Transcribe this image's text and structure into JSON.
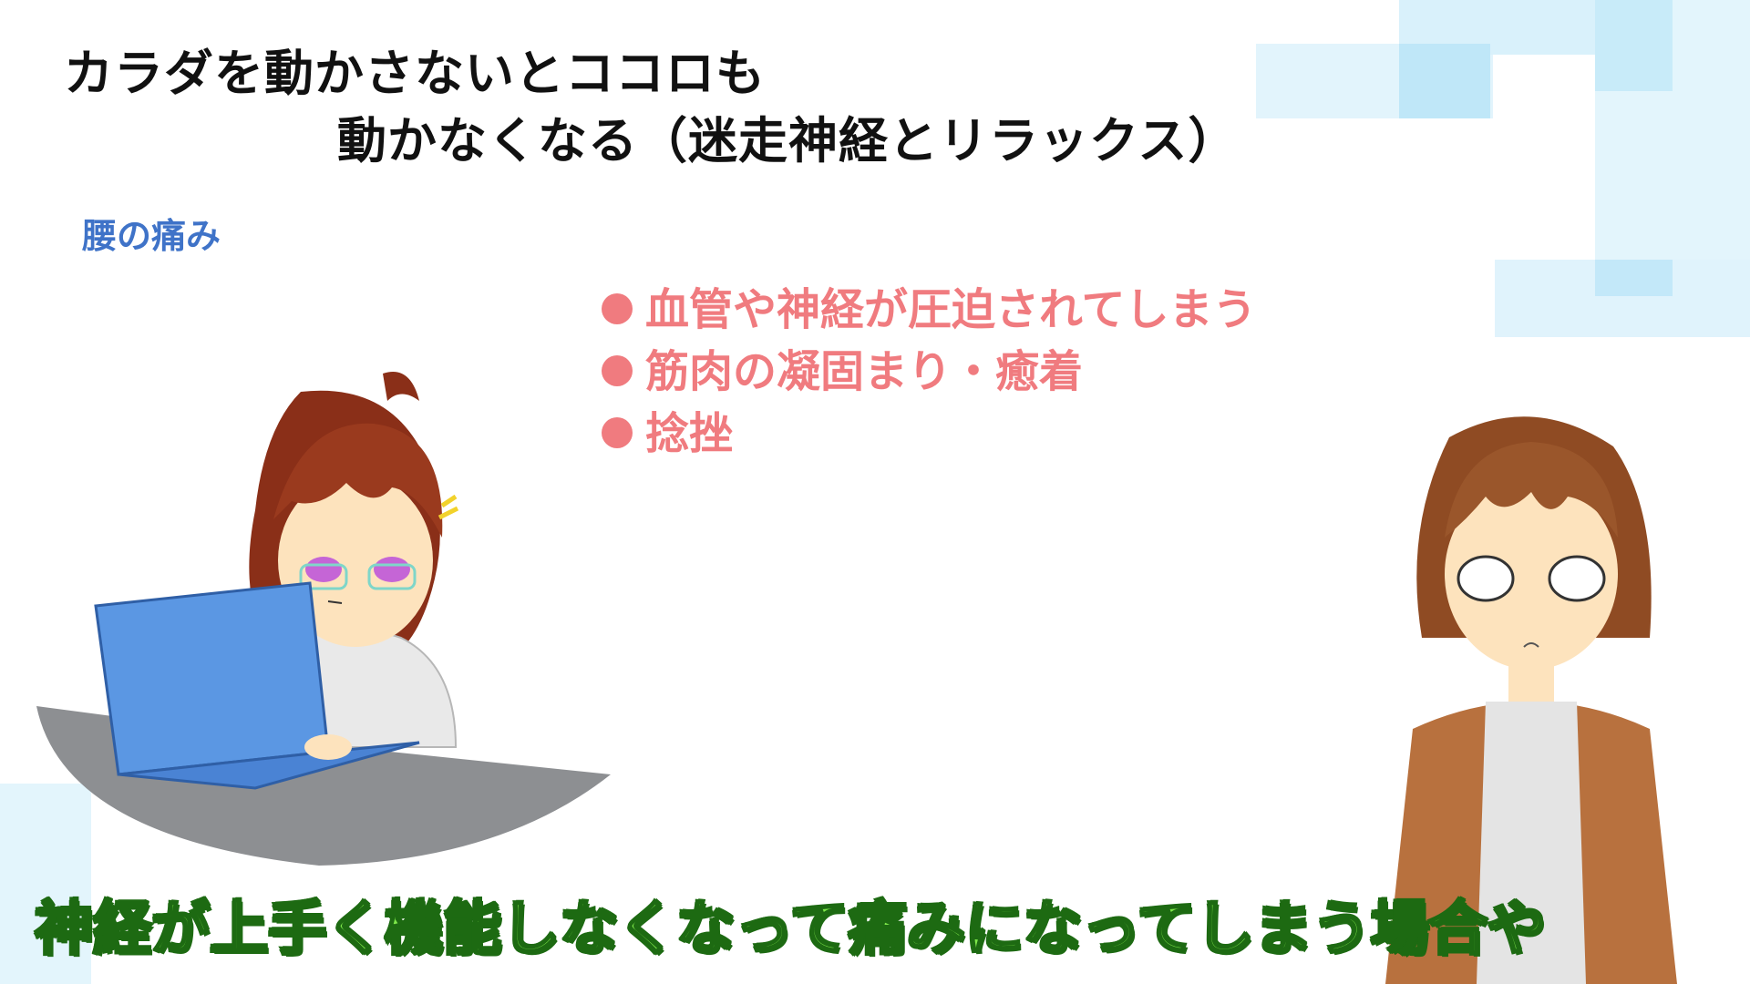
{
  "title": {
    "line1": "カラダを動かさないとココロも",
    "line2": "動かなくなる（迷走神経とリラックス）"
  },
  "subtitle": "腰の痛み",
  "bullets": [
    "血管や神経が圧迫されてしまう",
    "筋肉の凝固まり・癒着",
    "捻挫"
  ],
  "caption": "神経が上手く機能しなくなって痛みになってしまう場合や",
  "colors": {
    "accent_blue": "#3f73c8",
    "bullet_pink": "#f07b7f",
    "caption_green": "#7ee84a",
    "caption_outline": "#1d6a12",
    "deco_blue": "#cfeefb"
  },
  "illustrations": {
    "left_character": "girl-at-laptop",
    "right_character": "girl-dazed-eyes"
  }
}
